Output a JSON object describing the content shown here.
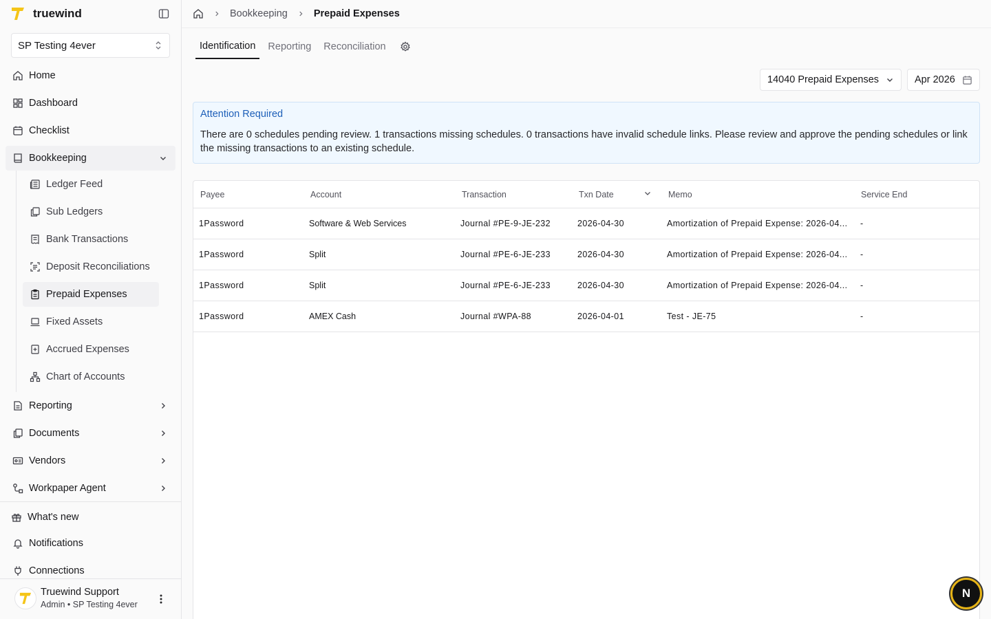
{
  "brand": {
    "name": "truewind"
  },
  "org_select": {
    "value": "SP Testing 4ever"
  },
  "nav": {
    "home": "Home",
    "dashboard": "Dashboard",
    "checklist": "Checklist",
    "bookkeeping": "Bookkeeping",
    "sub": [
      "Ledger Feed",
      "Sub Ledgers",
      "Bank Transactions",
      "Deposit Reconciliations",
      "Prepaid Expenses",
      "Fixed Assets",
      "Accrued Expenses",
      "Chart of Accounts"
    ],
    "reporting": "Reporting",
    "documents": "Documents",
    "vendors": "Vendors",
    "workpaper": "Workpaper Agent",
    "whats_new": "What's new",
    "notifications": "Notifications",
    "connections": "Connections"
  },
  "user": {
    "name": "Truewind Support",
    "role": "Admin • SP Testing 4ever"
  },
  "breadcrumb": {
    "section": "Bookkeeping",
    "current": "Prepaid Expenses"
  },
  "tabs": [
    "Identification",
    "Reporting",
    "Reconciliation"
  ],
  "filters": {
    "account": "14040 Prepaid Expenses",
    "period": "Apr 2026"
  },
  "alert": {
    "title": "Attention Required",
    "body": "There are 0 schedules pending review. 1 transactions missing schedules. 0 transactions have invalid schedule links. Please review and approve the pending schedules or link the missing transactions to an existing schedule."
  },
  "table": {
    "columns": [
      "Payee",
      "Account",
      "Transaction",
      "Txn Date",
      "Memo",
      "Service End"
    ],
    "rows": [
      [
        "1Password",
        "Software & Web Services",
        "Journal #PE-9-JE-232",
        "2026-04-30",
        "Amortization of Prepaid Expense: 2026-04...",
        "-"
      ],
      [
        "1Password",
        "Split",
        "Journal #PE-6-JE-233",
        "2026-04-30",
        "Amortization of Prepaid Expense: 2026-04...",
        "-"
      ],
      [
        "1Password",
        "Split",
        "Journal #PE-6-JE-233",
        "2026-04-30",
        "Amortization of Prepaid Expense: 2026-04...",
        "-"
      ],
      [
        "1Password",
        "AMEX Cash",
        "Journal #WPA-88",
        "2026-04-01",
        "Test - JE-75",
        "-"
      ]
    ]
  },
  "badge": {
    "letter": "N"
  },
  "colors": {
    "brand_yellow": "#f5c518",
    "alert_blue": "#1d5fb8",
    "alert_bg": "#f0f8ff"
  }
}
